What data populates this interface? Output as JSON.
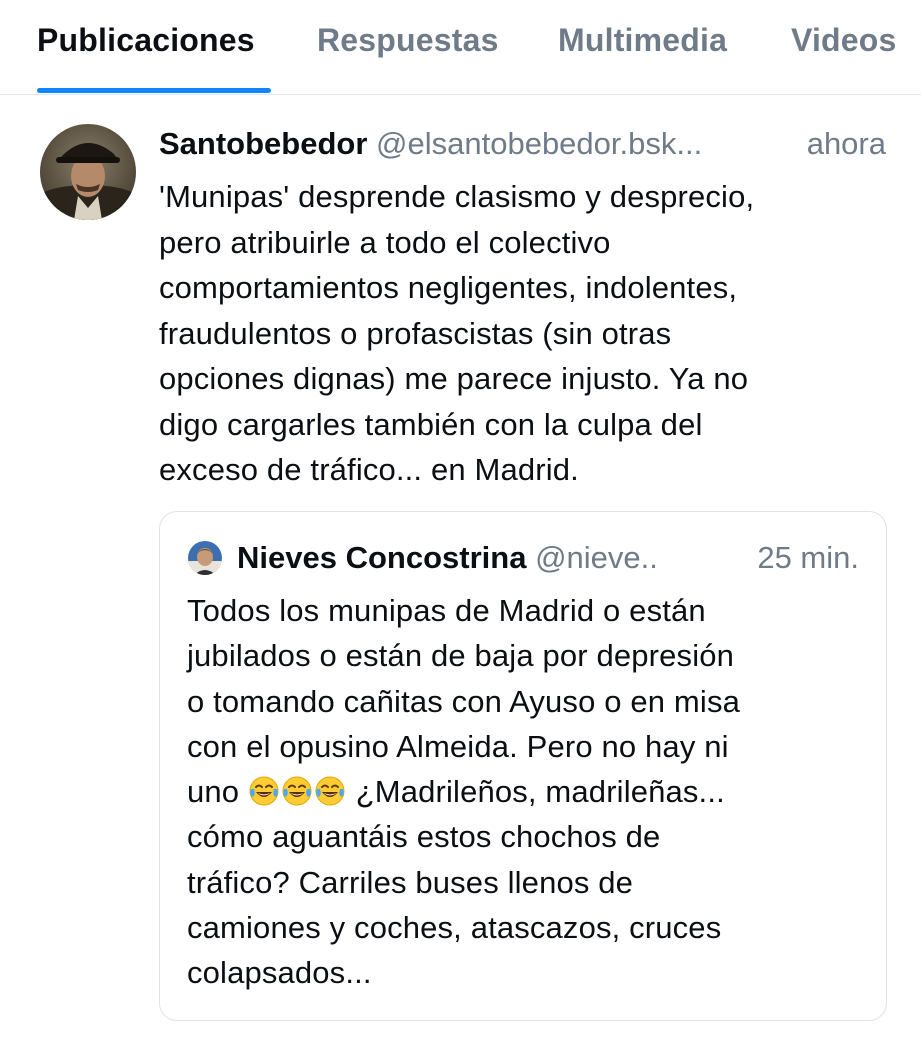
{
  "tabs": [
    {
      "label": "Publicaciones",
      "active": true
    },
    {
      "label": "Respuestas",
      "active": false
    },
    {
      "label": "Multimedia",
      "active": false
    },
    {
      "label": "Videos",
      "active": false
    }
  ],
  "colors": {
    "accent": "#1185fe",
    "text_primary": "#0b0f14",
    "text_secondary": "#6f7b89",
    "border": "#dfe3e8"
  },
  "post": {
    "author_name": "Santobebedor",
    "author_handle": "@elsantobebedor.bsk...",
    "time": "ahora",
    "text": "'Munipas' desprende clasismo y desprecio,\npero atribuirle a todo el colectivo\ncomportamientos negligentes, indolentes,\nfraudulentos o profascistas (sin otras\nopciones dignas) me parece injusto. Ya no\ndigo cargarles también con la culpa del\nexceso de tráfico... en Madrid.",
    "quote": {
      "author_name": "Nieves Concostrina",
      "author_handle": "@nieve...",
      "time": "25 min.",
      "lines": {
        "l1": "Todos los munipas de Madrid o están",
        "l2": "jubilados o están de baja por depresión",
        "l3": "o tomando cañitas con Ayuso o en misa",
        "l4": "con el opusino Almeida. Pero no hay ni",
        "l5_start": "uno ",
        "l5_end": " ¿Madrileños, madrileñas...",
        "l6": "cómo aguantáis estos chochos de",
        "l7": "tráfico? Carriles buses llenos de",
        "l8": "camiones y coches, atascazos, cruces",
        "l9": "colapsados..."
      },
      "emojis": [
        "tears-of-joy-emoji",
        "tears-of-joy-emoji",
        "tears-of-joy-emoji"
      ]
    }
  }
}
